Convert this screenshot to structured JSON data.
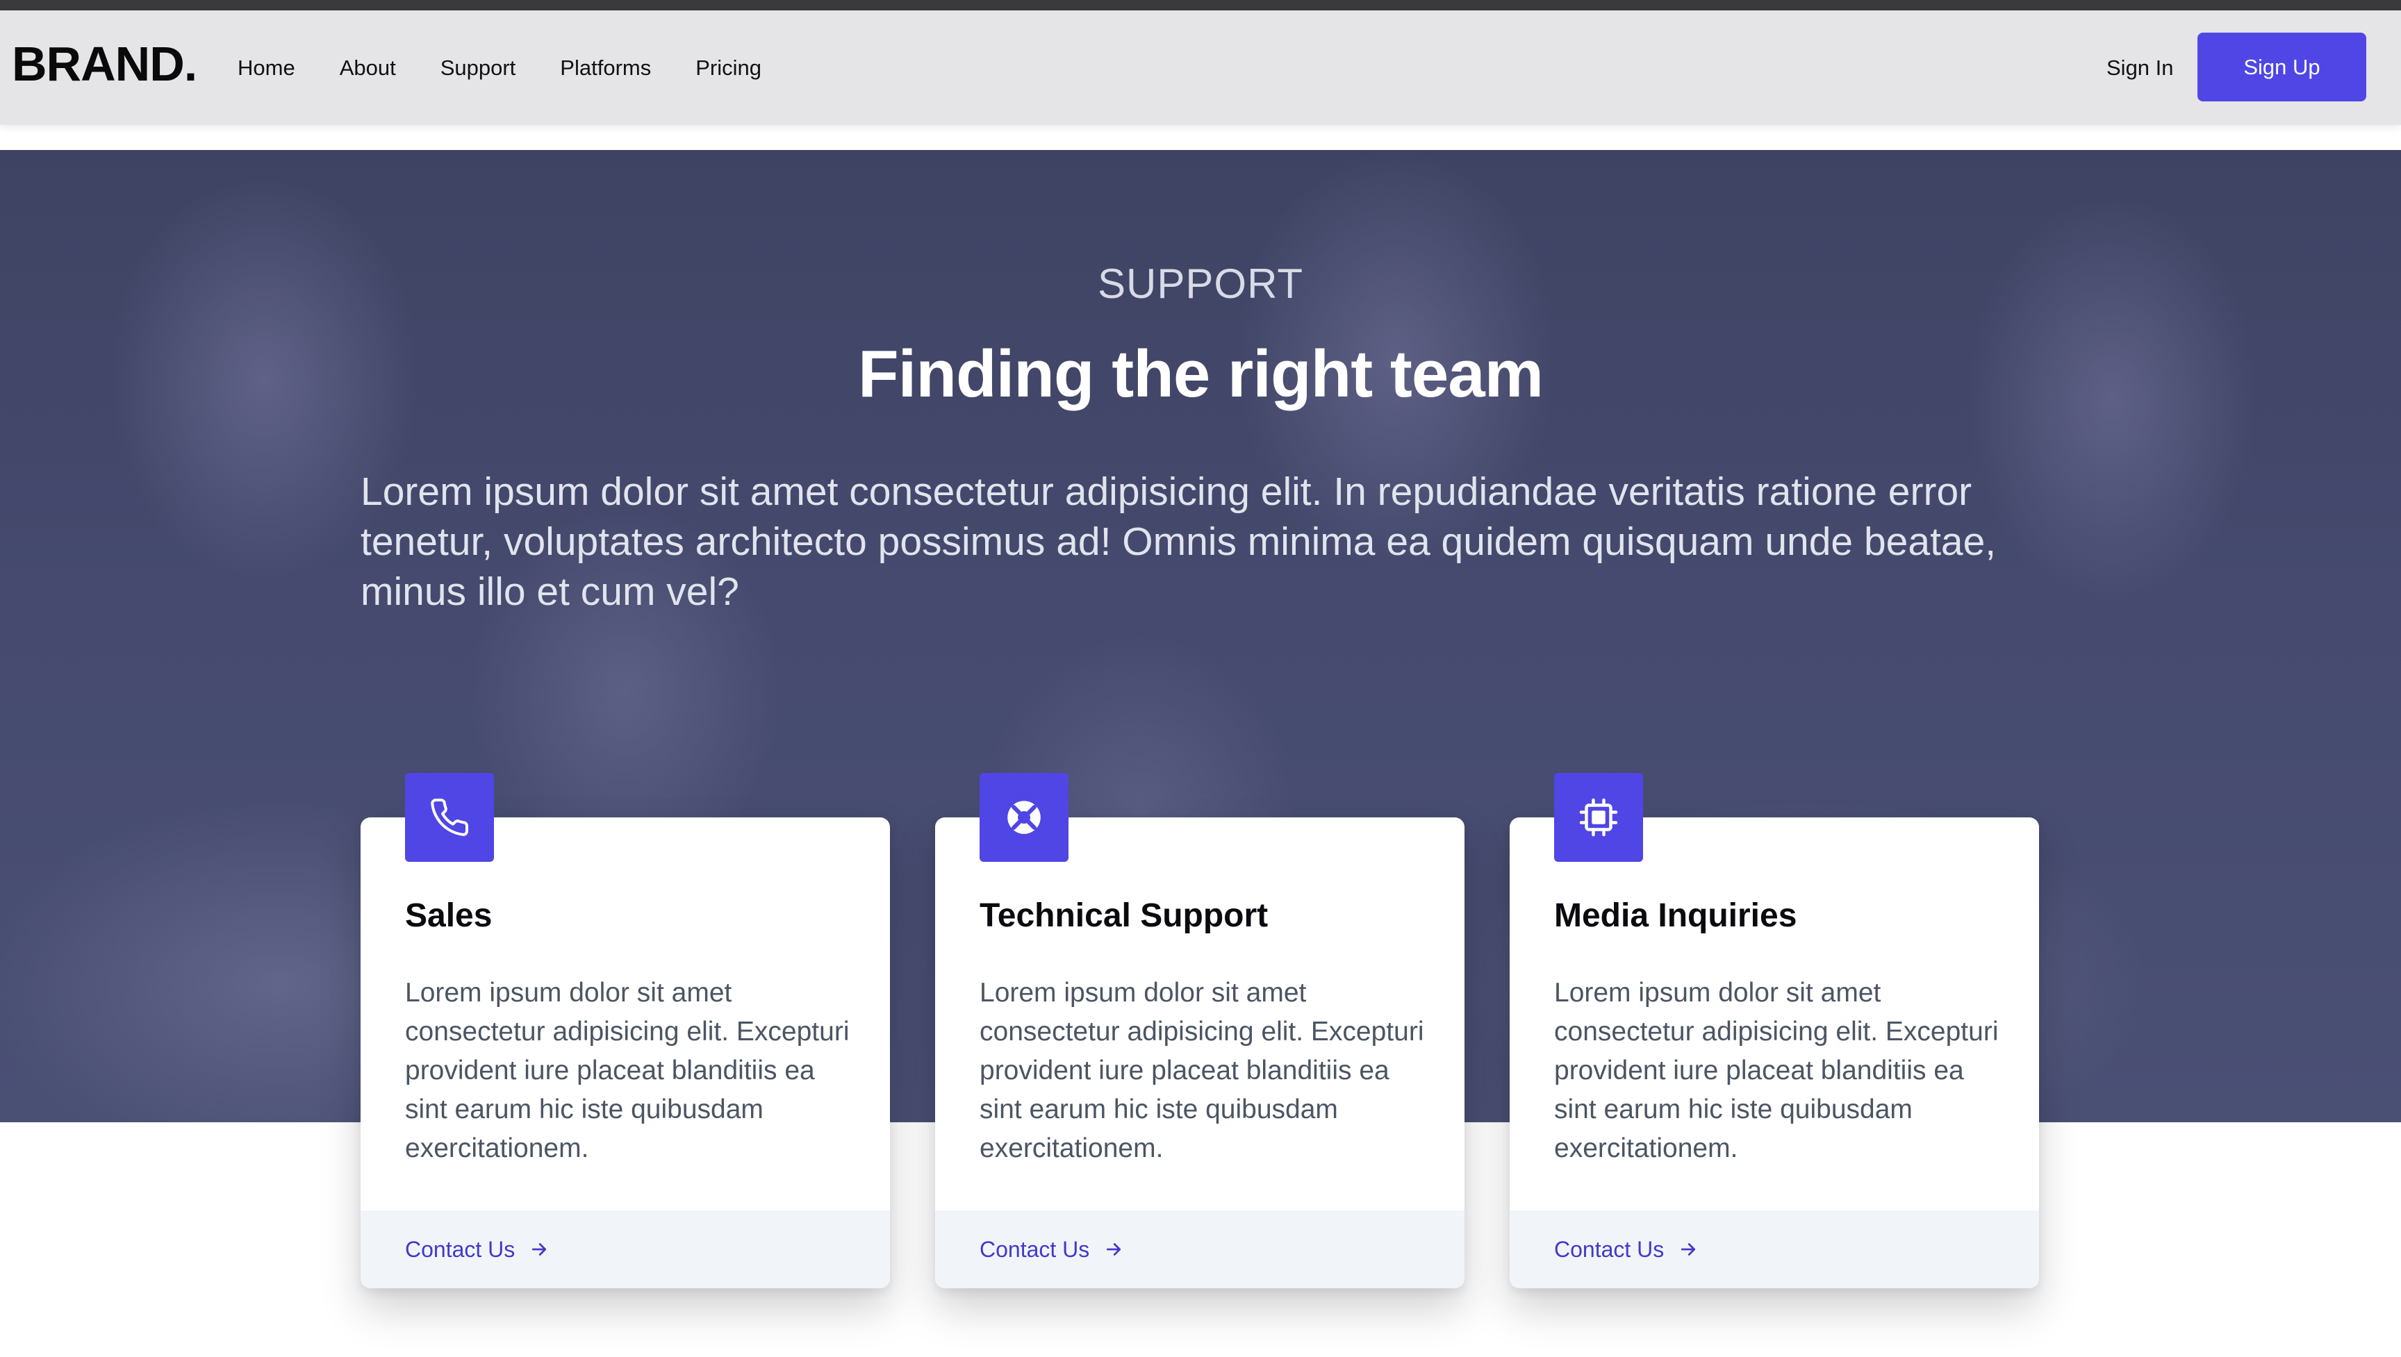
{
  "header": {
    "brand": "BRAND.",
    "nav": [
      "Home",
      "About",
      "Support",
      "Platforms",
      "Pricing"
    ],
    "sign_in": "Sign In",
    "sign_up": "Sign Up"
  },
  "hero": {
    "eyebrow": "SUPPORT",
    "title": "Finding the right team",
    "text": "Lorem ipsum dolor sit amet consectetur adipisicing elit. In repudiandae veritatis ratione error tenetur, voluptates architecto possimus ad! Omnis minima ea quidem quisquam unde beatae, minus illo et cum vel?"
  },
  "cards": [
    {
      "icon": "phone-icon",
      "title": "Sales",
      "text": "Lorem ipsum dolor sit amet consectetur adipisicing elit. Excepturi provident iure placeat blanditiis ea sint earum hic iste quibusdam exercitationem.",
      "link": "Contact Us"
    },
    {
      "icon": "lifebuoy-icon",
      "title": "Technical Support",
      "text": "Lorem ipsum dolor sit amet consectetur adipisicing elit. Excepturi provident iure placeat blanditiis ea sint earum hic iste quibusdam exercitationem.",
      "link": "Contact Us"
    },
    {
      "icon": "chip-icon",
      "title": "Media Inquiries",
      "text": "Lorem ipsum dolor sit amet consectetur adipisicing elit. Excepturi provident iure placeat blanditiis ea sint earum hic iste quibusdam exercitationem.",
      "link": "Contact Us"
    }
  ],
  "colors": {
    "accent": "#4f46e5",
    "link": "#4338ca",
    "navbar_bg": "#e5e5e7",
    "hero_overlay": "#454a6e",
    "card_footer_bg": "#f1f5f9"
  }
}
